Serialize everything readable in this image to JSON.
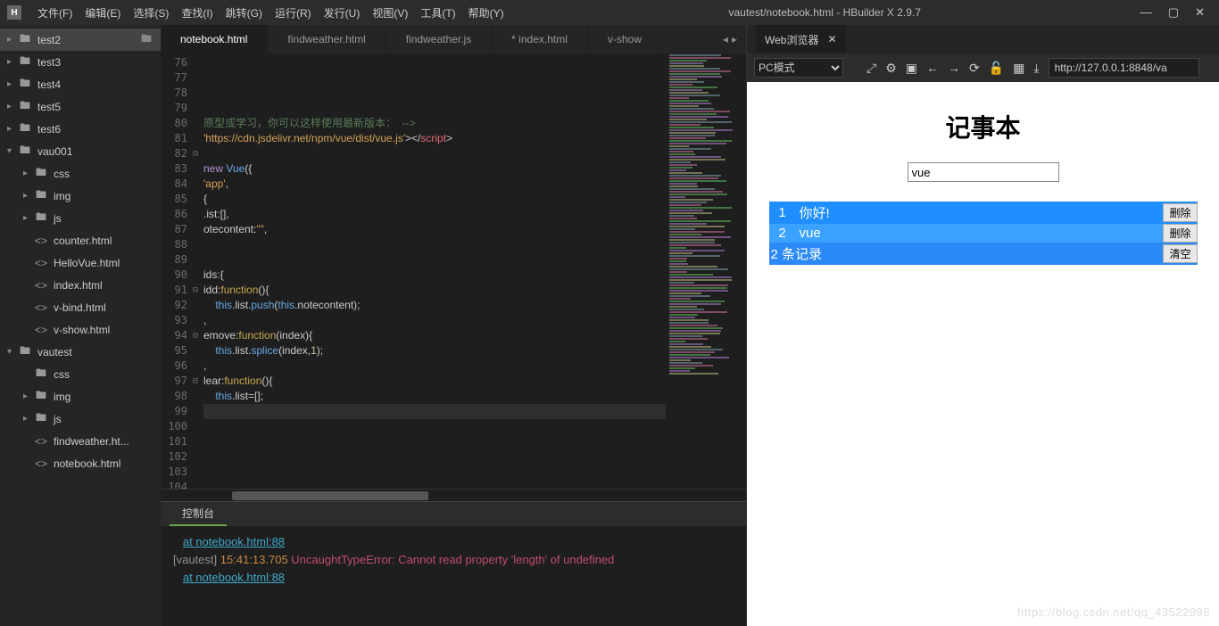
{
  "window": {
    "title": "vautest/notebook.html - HBuilder X 2.9.7",
    "logo": "H"
  },
  "menu": [
    "文件(F)",
    "编辑(E)",
    "选择(S)",
    "查找(I)",
    "跳转(G)",
    "运行(R)",
    "发行(U)",
    "视图(V)",
    "工具(T)",
    "帮助(Y)"
  ],
  "sidebar": [
    {
      "depth": 1,
      "chev": "▸",
      "icon": "folder",
      "label": "test2",
      "selected": true,
      "trail": "folder-open"
    },
    {
      "depth": 1,
      "chev": "▸",
      "icon": "folder",
      "label": "test3"
    },
    {
      "depth": 1,
      "chev": "▸",
      "icon": "folder",
      "label": "test4"
    },
    {
      "depth": 1,
      "chev": "▸",
      "icon": "folder",
      "label": "test5"
    },
    {
      "depth": 1,
      "chev": "▸",
      "icon": "folder",
      "label": "test6"
    },
    {
      "depth": 1,
      "chev": "▾",
      "icon": "folder",
      "label": "vau001"
    },
    {
      "depth": 2,
      "chev": "▸",
      "icon": "folder",
      "label": "css"
    },
    {
      "depth": 2,
      "chev": "▸",
      "icon": "folder",
      "label": "img"
    },
    {
      "depth": 2,
      "chev": "▸",
      "icon": "folder",
      "label": "js"
    },
    {
      "depth": 2,
      "chev": "",
      "icon": "<>",
      "label": "counter.html"
    },
    {
      "depth": 2,
      "chev": "",
      "icon": "<>",
      "label": "HelloVue.html"
    },
    {
      "depth": 2,
      "chev": "",
      "icon": "<>",
      "label": "index.html"
    },
    {
      "depth": 2,
      "chev": "",
      "icon": "<>",
      "label": "v-bind.html"
    },
    {
      "depth": 2,
      "chev": "",
      "icon": "<>",
      "label": "v-show.html"
    },
    {
      "depth": 1,
      "chev": "▾",
      "icon": "folder",
      "label": "vautest"
    },
    {
      "depth": 2,
      "chev": "",
      "icon": "folder",
      "label": "css"
    },
    {
      "depth": 2,
      "chev": "▸",
      "icon": "folder",
      "label": "img"
    },
    {
      "depth": 2,
      "chev": "▸",
      "icon": "folder",
      "label": "js"
    },
    {
      "depth": 2,
      "chev": "",
      "icon": "<>",
      "label": "findweather.ht..."
    },
    {
      "depth": 2,
      "chev": "",
      "icon": "<>",
      "label": "notebook.html"
    }
  ],
  "tabs": [
    {
      "label": "notebook.html",
      "active": true
    },
    {
      "label": "findweather.html"
    },
    {
      "label": "findweather.js"
    },
    {
      "label": "* index.html"
    },
    {
      "label": "v-show"
    }
  ],
  "code": {
    "start": 76,
    "lines": [
      {
        "n": 76,
        "html": ""
      },
      {
        "n": 77,
        "html": ""
      },
      {
        "n": 78,
        "html": ""
      },
      {
        "n": 79,
        "html": ""
      },
      {
        "n": 80,
        "html": "<span class='com'>原型或学习，你可以这样使用最新版本：  --&gt;</span>"
      },
      {
        "n": 81,
        "html": "<span class='str'>'https://cdn.jsdelivr.net/npm/vue/dist/vue.js'</span>&gt;&lt;/<span class='tag'>script</span>&gt;"
      },
      {
        "n": 82,
        "html": "",
        "fold": "⊟"
      },
      {
        "n": 83,
        "html": "<span class='kw'>new</span> <span class='id'>Vue</span>({"
      },
      {
        "n": 84,
        "html": "<span class='str'>'app'</span>,"
      },
      {
        "n": 85,
        "html": "{"
      },
      {
        "n": 86,
        "html": ".ist:[],"
      },
      {
        "n": 87,
        "html": "otecontent:<span class='str'>\"\"</span>,"
      },
      {
        "n": 88,
        "html": ""
      },
      {
        "n": 89,
        "html": ""
      },
      {
        "n": 90,
        "html": "ids:{"
      },
      {
        "n": 91,
        "html": "idd:<span class='fn'>function</span>(){",
        "fold": "⊟"
      },
      {
        "n": 92,
        "html": "    <span class='this'>this</span>.list.<span class='id'>push</span>(<span class='this'>this</span>.notecontent);"
      },
      {
        "n": 93,
        "html": ","
      },
      {
        "n": 94,
        "html": "emove:<span class='fn'>function</span>(index){",
        "fold": "⊟"
      },
      {
        "n": 95,
        "html": "    <span class='this'>this</span>.list.<span class='id'>splice</span>(index,<span class='num'>1</span>);"
      },
      {
        "n": 96,
        "html": ","
      },
      {
        "n": 97,
        "html": "lear:<span class='fn'>function</span>(){",
        "fold": "⊟"
      },
      {
        "n": 98,
        "html": "    <span class='this'>this</span>.list=[];"
      },
      {
        "n": 99,
        "html": "",
        "hl": true
      },
      {
        "n": 100,
        "html": ""
      },
      {
        "n": 101,
        "html": ""
      },
      {
        "n": 102,
        "html": ""
      },
      {
        "n": 103,
        "html": ""
      },
      {
        "n": 104,
        "html": ""
      }
    ]
  },
  "browser": {
    "tab": "Web浏览器",
    "mode": "PC模式",
    "url": "http://127.0.0.1:8848/va",
    "icons": [
      "⤢",
      "⚙",
      "▣",
      "←",
      "→",
      "⟳",
      "🔒",
      "⌗",
      "⤓"
    ]
  },
  "preview": {
    "title": "记事本",
    "input": "vue",
    "rows": [
      {
        "idx": "1",
        "text": "你好!",
        "btn": "删除",
        "cls": "r1"
      },
      {
        "idx": "2",
        "text": "vue",
        "btn": "删除",
        "cls": "r2"
      }
    ],
    "footer": {
      "text": "2 条记录",
      "btn": "清空"
    },
    "watermark": "https://blog.csdn.net/qq_43522998"
  },
  "console": {
    "tab": "控制台",
    "lines": [
      {
        "type": "link",
        "text": "at notebook.html:88"
      },
      {
        "type": "err",
        "prefix": "[vautest]",
        "ts": "15:41:13.705",
        "etype": "UncaughtTypeError:",
        "msg": "Cannot read property 'length' of undefined"
      },
      {
        "type": "link",
        "text": "at notebook.html:88"
      }
    ]
  }
}
